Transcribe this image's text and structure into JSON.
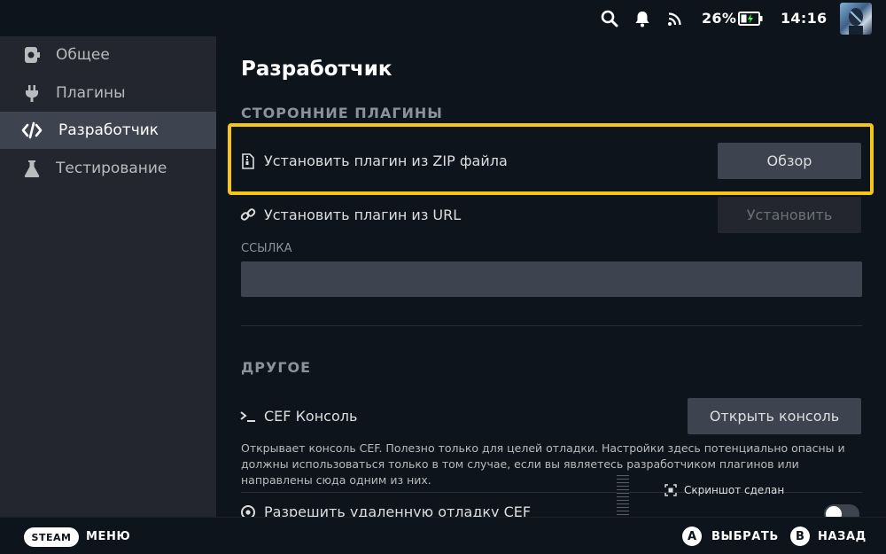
{
  "statusbar": {
    "battery_percent": "26%",
    "time": "14:16",
    "icons": [
      "search-icon",
      "bell-icon",
      "wifi-icon",
      "battery-charging-icon"
    ]
  },
  "sidebar": {
    "items": [
      {
        "label": "Общее",
        "icon": "general-icon",
        "active": false
      },
      {
        "label": "Плагины",
        "icon": "plug-icon",
        "active": false
      },
      {
        "label": "Разработчик",
        "icon": "code-icon",
        "active": true
      },
      {
        "label": "Тестирование",
        "icon": "flask-icon",
        "active": false
      }
    ]
  },
  "main": {
    "title": "Разработчик",
    "third_party": {
      "section_title": "СТОРОННИЕ ПЛАГИНЫ",
      "zip_row": {
        "label": "Установить плагин из ZIP файла",
        "button": "Обзор"
      },
      "url_row": {
        "label": "Установить плагин из URL",
        "button": "Установить"
      },
      "link_field": {
        "label": "ССЫЛКА",
        "value": ""
      }
    },
    "other": {
      "section_title": "ДРУГОЕ",
      "cef_console": {
        "label": "CEF Консоль",
        "button": "Открыть консоль",
        "description": "Открывает консоль CEF. Полезно только для целей отладки. Настройки здесь потенциально опасны и должны использоваться только в том случае, если вы являетесь разработчиком плагинов или направлены сюда одним из них."
      },
      "remote_debug": {
        "label": "Разрешить удаленную отладку CEF",
        "enabled": false
      }
    }
  },
  "toast": {
    "text": "Скриншот сделан"
  },
  "bottombar": {
    "steam_label": "STEAM",
    "menu_label": "МЕНЮ",
    "a_glyph": "A",
    "a_label": "ВЫБРАТЬ",
    "b_glyph": "B",
    "b_label": "НАЗАД"
  },
  "colors": {
    "focus": "#f5c518",
    "background": "#0e141b",
    "sidebar": "#23262e",
    "button": "#3d4450"
  }
}
